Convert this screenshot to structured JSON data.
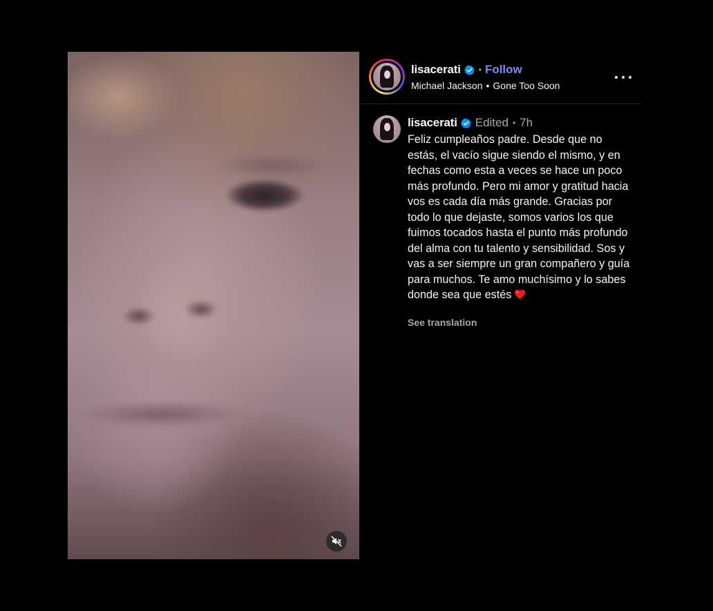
{
  "media": {
    "type": "video",
    "muted": true,
    "mute_icon": "speaker-muted-icon"
  },
  "header": {
    "username": "lisacerati",
    "verified": true,
    "separator": "•",
    "follow_label": "Follow",
    "audio_artist": "Michael Jackson",
    "audio_separator": "•",
    "audio_title": "Gone Too Soon",
    "more_icon": "more-horizontal-icon"
  },
  "caption": {
    "username": "lisacerati",
    "verified": true,
    "edited_label": "Edited",
    "separator": "•",
    "time": "7h",
    "text": "Feliz cumpleaños padre. Desde que no estás, el vacío sigue siendo el mismo, y en fechas como esta a veces se hace un poco más profundo. Pero mi amor y gratitud hacia vos es cada día más grande. Gracias por todo lo que dejaste, somos varios los que fuimos tocados hasta el punto más profundo del alma con tu talento y sensibilidad. Sos y vas a ser siempre un gran compañero y guía para muchos. Te amo muchísimo y lo sabes donde sea que estés",
    "emoji": "❤️",
    "see_translation": "See translation"
  },
  "colors": {
    "background": "#000000",
    "text": "#f5f5f5",
    "secondary_text": "#a8a8a8",
    "follow_link": "#7f87f2",
    "verified_badge": "#0095f6",
    "heart": "#ed1c24"
  }
}
